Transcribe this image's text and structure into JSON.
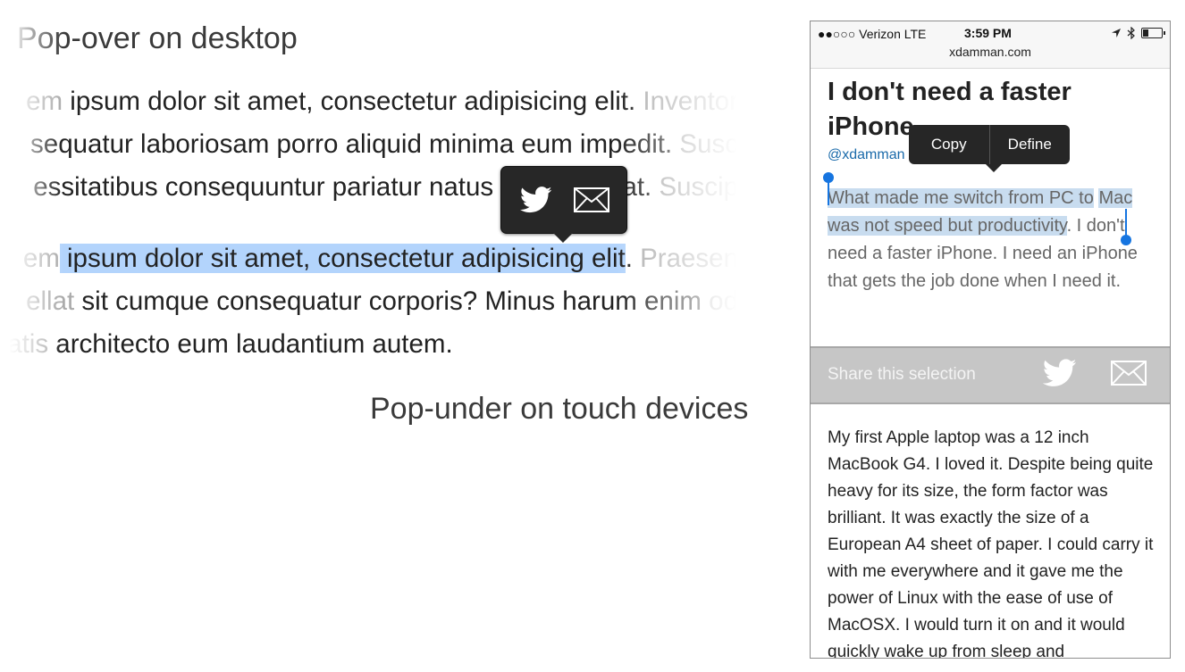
{
  "headings": {
    "desktop": "Pop-over on desktop",
    "touch": "Pop-under on touch devices"
  },
  "desktop_text": {
    "l1": {
      "faded_start": "em",
      "main": " ipsum dolor sit amet, consectetur adipisicing elit. ",
      "faded_end": "Inventor"
    },
    "l2": {
      "faded_start": "",
      "main": "sequatur laboriosam porro aliquid minima eum impedit. ",
      "faded_end": "Susc"
    },
    "l3": {
      "faded_start": "",
      "main": "essitatibus consequuntur pariatur natus quia repellat. ",
      "faded_end": "Suscip"
    },
    "l4": {
      "faded_start": "em",
      "selected": " ipsum dolor sit amet, consectetur adipisicing elit",
      "main": ". ",
      "faded_end": "Praesen"
    },
    "l5": {
      "faded_start": "ellat",
      "main": " sit cumque consequatur corporis? Minus harum enim ",
      "faded_end": "od"
    },
    "l6": {
      "faded_start": "tatis",
      "main": " architecto eum laudantium autem.",
      "faded_end": ""
    }
  },
  "popover": {
    "tweet_icon": "twitter-bird-icon",
    "mail_icon": "envelope-icon"
  },
  "phone": {
    "status": {
      "carrier": "●●○○○ Verizon  LTE",
      "time": "3:59 PM",
      "url": "xdamman.com",
      "battery_level": 0.3
    },
    "title": "I don't need a faster iPhone",
    "byline": "@xdamman",
    "menu": {
      "copy": "Copy",
      "define": "Define"
    },
    "excerpt": {
      "selected_1": "What made me switch from PC to",
      "selected_2": "Mac was not speed but productivity",
      "rest": ". I don't need a faster iPhone. I need an iPhone that gets the job done when I need it."
    },
    "share_bar": {
      "label": "Share this selection"
    },
    "body": "My first Apple laptop was a 12 inch MacBook G4. I loved it. Despite being quite heavy for its size, the form factor was brilliant. It was exactly the size of a European A4 sheet of paper. I could carry it with me everywhere and it gave me the power of Linux with the ease of use of MacOSX. I would turn it on and it would quickly wake up from sleep and"
  },
  "colors": {
    "selection": "#b3d4fc",
    "popover": "#272727",
    "link": "#1a6aaa",
    "handle": "#1675e0"
  }
}
